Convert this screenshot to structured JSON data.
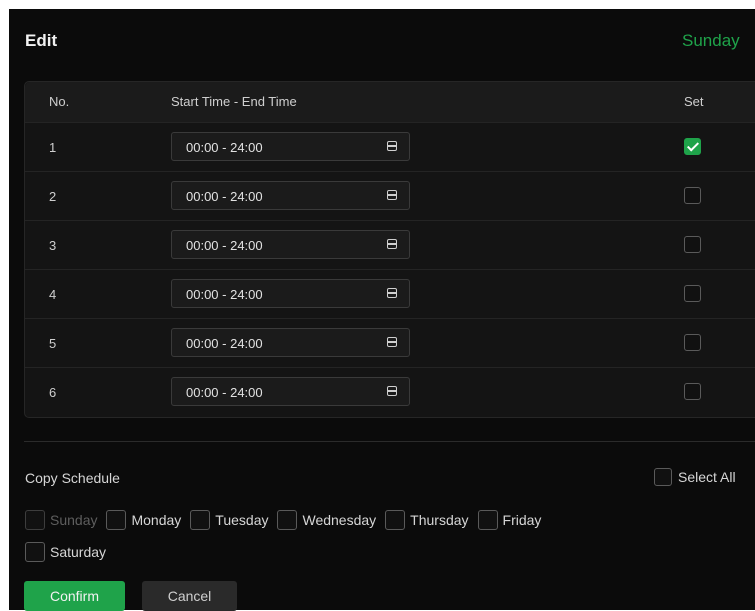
{
  "dialog": {
    "title": "Edit",
    "day": "Sunday"
  },
  "table": {
    "headers": {
      "no": "No.",
      "time": "Start Time - End Time",
      "set": "Set"
    },
    "rows": [
      {
        "no": "1",
        "time": "00:00 - 24:00",
        "set": true
      },
      {
        "no": "2",
        "time": "00:00 - 24:00",
        "set": false
      },
      {
        "no": "3",
        "time": "00:00 - 24:00",
        "set": false
      },
      {
        "no": "4",
        "time": "00:00 - 24:00",
        "set": false
      },
      {
        "no": "5",
        "time": "00:00 - 24:00",
        "set": false
      },
      {
        "no": "6",
        "time": "00:00 - 24:00",
        "set": false
      }
    ]
  },
  "copy_schedule": {
    "label": "Copy Schedule",
    "select_all": "Select All",
    "days": [
      {
        "label": "Sunday",
        "disabled": true
      },
      {
        "label": "Monday",
        "disabled": false
      },
      {
        "label": "Tuesday",
        "disabled": false
      },
      {
        "label": "Wednesday",
        "disabled": false
      },
      {
        "label": "Thursday",
        "disabled": false
      },
      {
        "label": "Friday",
        "disabled": false
      },
      {
        "label": "Saturday",
        "disabled": false
      }
    ]
  },
  "buttons": {
    "confirm": "Confirm",
    "cancel": "Cancel"
  },
  "icons": {
    "time_field": "calendar-icon",
    "checkbox_checked": "checkmark-icon"
  },
  "colors": {
    "accent": "#1fa34a",
    "background": "#0b0b0b"
  }
}
